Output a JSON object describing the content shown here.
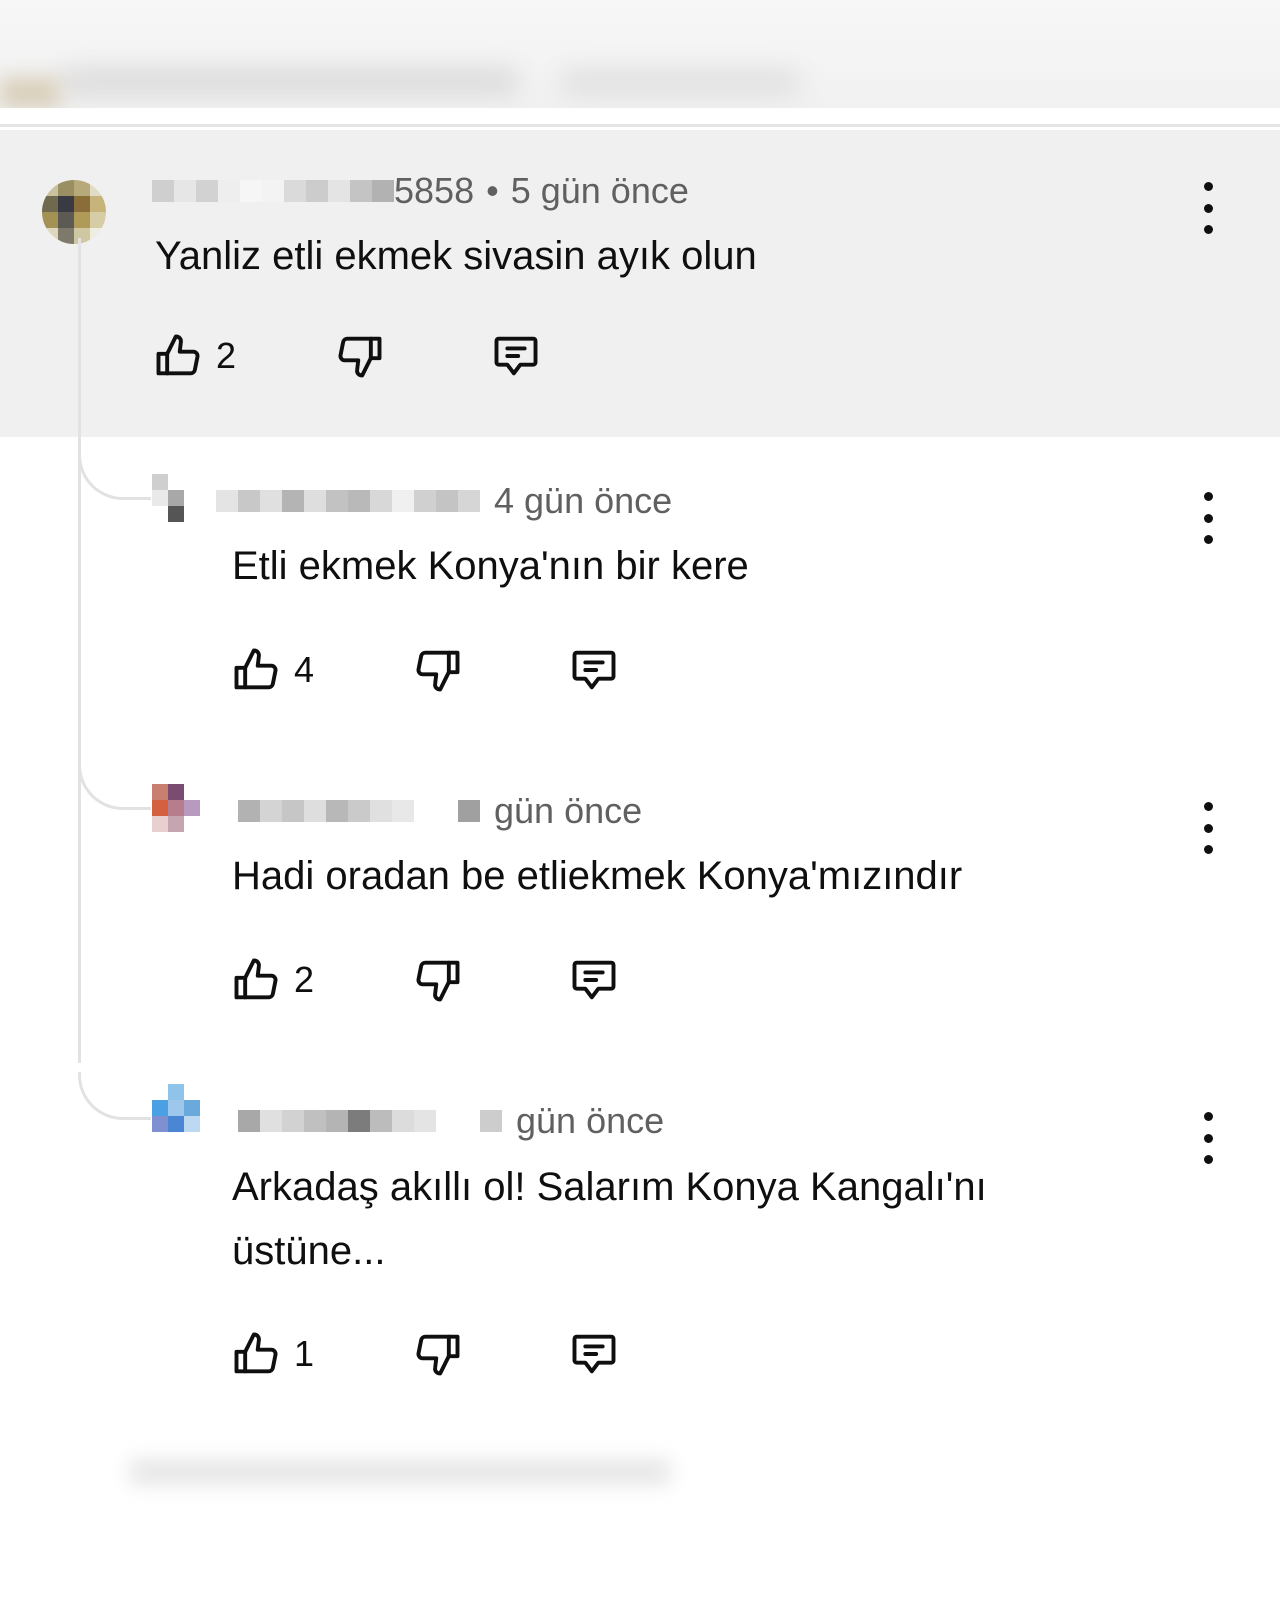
{
  "comments": [
    {
      "username_suffix": "5858",
      "separator": "•",
      "time": "5 gün önce",
      "text": "Yanliz etli ekmek sivasin ayık olun",
      "likes": "2",
      "icons": {
        "like": "thumbs-up-icon",
        "dislike": "thumbs-down-icon",
        "reply": "comment-icon",
        "menu": "more-vertical-icon"
      }
    },
    {
      "username_suffix": "",
      "time": "4 gün önce",
      "text": "Etli ekmek Konya'nın bir kere",
      "likes": "4"
    },
    {
      "username_suffix": "",
      "time": "gün önce",
      "text": "Hadi oradan be etliekmek Konya'mızındır",
      "likes": "2"
    },
    {
      "username_suffix": "",
      "time": "gün önce",
      "text": "Arkadaş akıllı ol! Salarım Konya Kangalı'nı üstüne...",
      "likes": "1"
    }
  ],
  "colors": {
    "highlight_bg": "#f0f0f0",
    "meta_text": "#606060",
    "body_text": "#0f0f0f",
    "thread_line": "#e2e2e2"
  }
}
